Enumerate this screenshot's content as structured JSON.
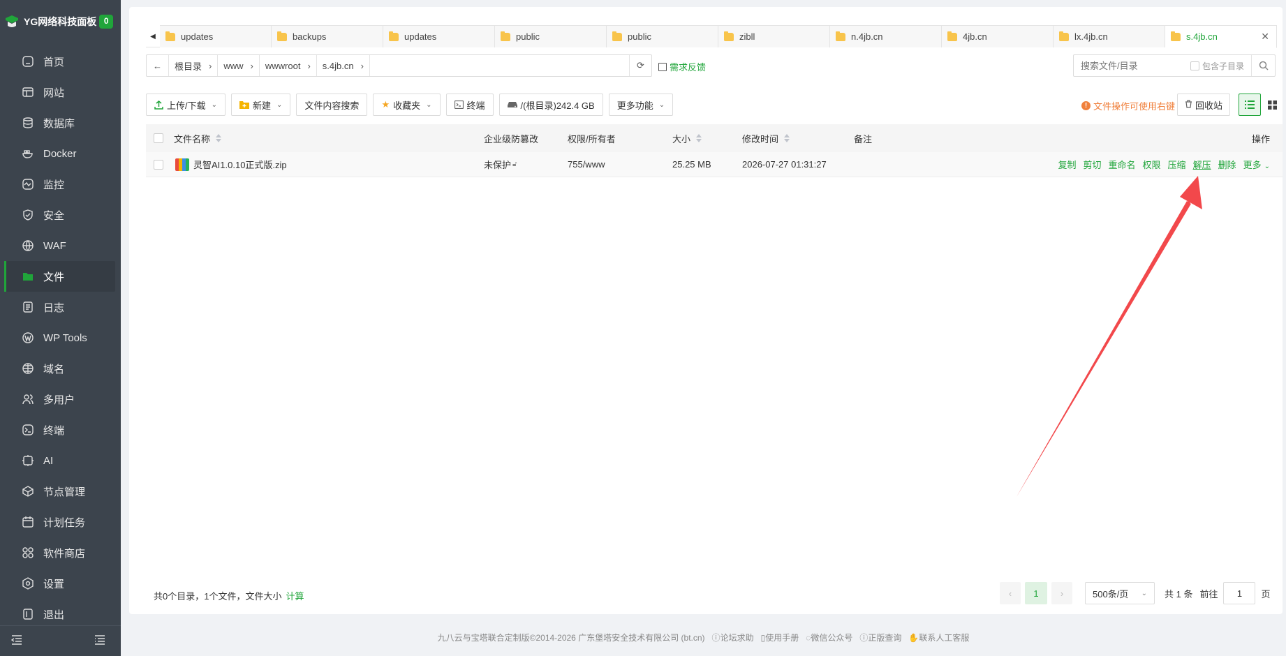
{
  "brand": {
    "title": "YG网络科技面板",
    "badge": "0"
  },
  "sidebar": {
    "items": [
      {
        "label": "首页",
        "icon": "home-icon"
      },
      {
        "label": "网站",
        "icon": "website-icon"
      },
      {
        "label": "数据库",
        "icon": "database-icon"
      },
      {
        "label": "Docker",
        "icon": "docker-icon"
      },
      {
        "label": "监控",
        "icon": "monitor-icon"
      },
      {
        "label": "安全",
        "icon": "shield-icon"
      },
      {
        "label": "WAF",
        "icon": "waf-icon"
      },
      {
        "label": "文件",
        "icon": "folder-icon",
        "active": true
      },
      {
        "label": "日志",
        "icon": "log-icon"
      },
      {
        "label": "WP Tools",
        "icon": "wordpress-icon"
      },
      {
        "label": "域名",
        "icon": "globe-icon"
      },
      {
        "label": "多用户",
        "icon": "users-icon"
      },
      {
        "label": "终端",
        "icon": "terminal-icon"
      },
      {
        "label": "AI",
        "icon": "ai-icon"
      },
      {
        "label": "节点管理",
        "icon": "node-icon"
      },
      {
        "label": "计划任务",
        "icon": "clock-icon"
      },
      {
        "label": "软件商店",
        "icon": "store-icon"
      },
      {
        "label": "设置",
        "icon": "gear-icon"
      },
      {
        "label": "退出",
        "icon": "logout-icon"
      }
    ]
  },
  "tabs": [
    "updates",
    "backups",
    "updates",
    "public",
    "public",
    "zibll",
    "n.4jb.cn",
    "4jb.cn",
    "lx.4jb.cn",
    "s.4jb.cn"
  ],
  "address": {
    "crumbs": [
      "根目录",
      "www",
      "wwwroot",
      "s.4jb.cn"
    ]
  },
  "feedback": "需求反馈",
  "search": {
    "placeholder": "搜索文件/目录",
    "subdir": "包含子目录"
  },
  "toolbar": {
    "upload": "上传/下载",
    "new": "新建",
    "content_search": "文件内容搜索",
    "favorites": "收藏夹",
    "terminal": "终端",
    "disk": "/(根目录)242.4 GB",
    "more": "更多功能",
    "tip": "文件操作可使用右键",
    "recycle": "回收站"
  },
  "table": {
    "headers": {
      "name": "文件名称",
      "protect": "企业级防篡改",
      "perm": "权限/所有者",
      "size": "大小",
      "mtime": "修改时间",
      "note": "备注",
      "ops": "操作"
    },
    "rows": [
      {
        "name": "灵智AI1.0.10正式版.zip",
        "protect": "未保护",
        "perm": "755/www",
        "size": "25.25 MB",
        "mtime": "2026-07-27 01:31:27",
        "note": ""
      }
    ],
    "ops": [
      "复制",
      "剪切",
      "重命名",
      "权限",
      "压缩",
      "解压",
      "删除",
      "更多"
    ]
  },
  "summary": {
    "text": "共0个目录，1个文件，文件大小",
    "calc": "计算"
  },
  "pager": {
    "current": "1",
    "per_page": "500条/页",
    "total": "共 1 条",
    "goto_label": "前往",
    "goto_value": "1",
    "page_unit": "页"
  },
  "footer": {
    "copyright": "九八云与宝塔联合定制版©2014-2026 广东堡塔安全技术有限公司 (bt.cn)",
    "links": [
      "论坛求助",
      "使用手册",
      "微信公众号",
      "正版查询",
      "联系人工客服"
    ]
  },
  "colors": {
    "accent": "#20a53a",
    "sidebar_bg": "#3c444d",
    "annotation_arrow": "#f2484b"
  }
}
